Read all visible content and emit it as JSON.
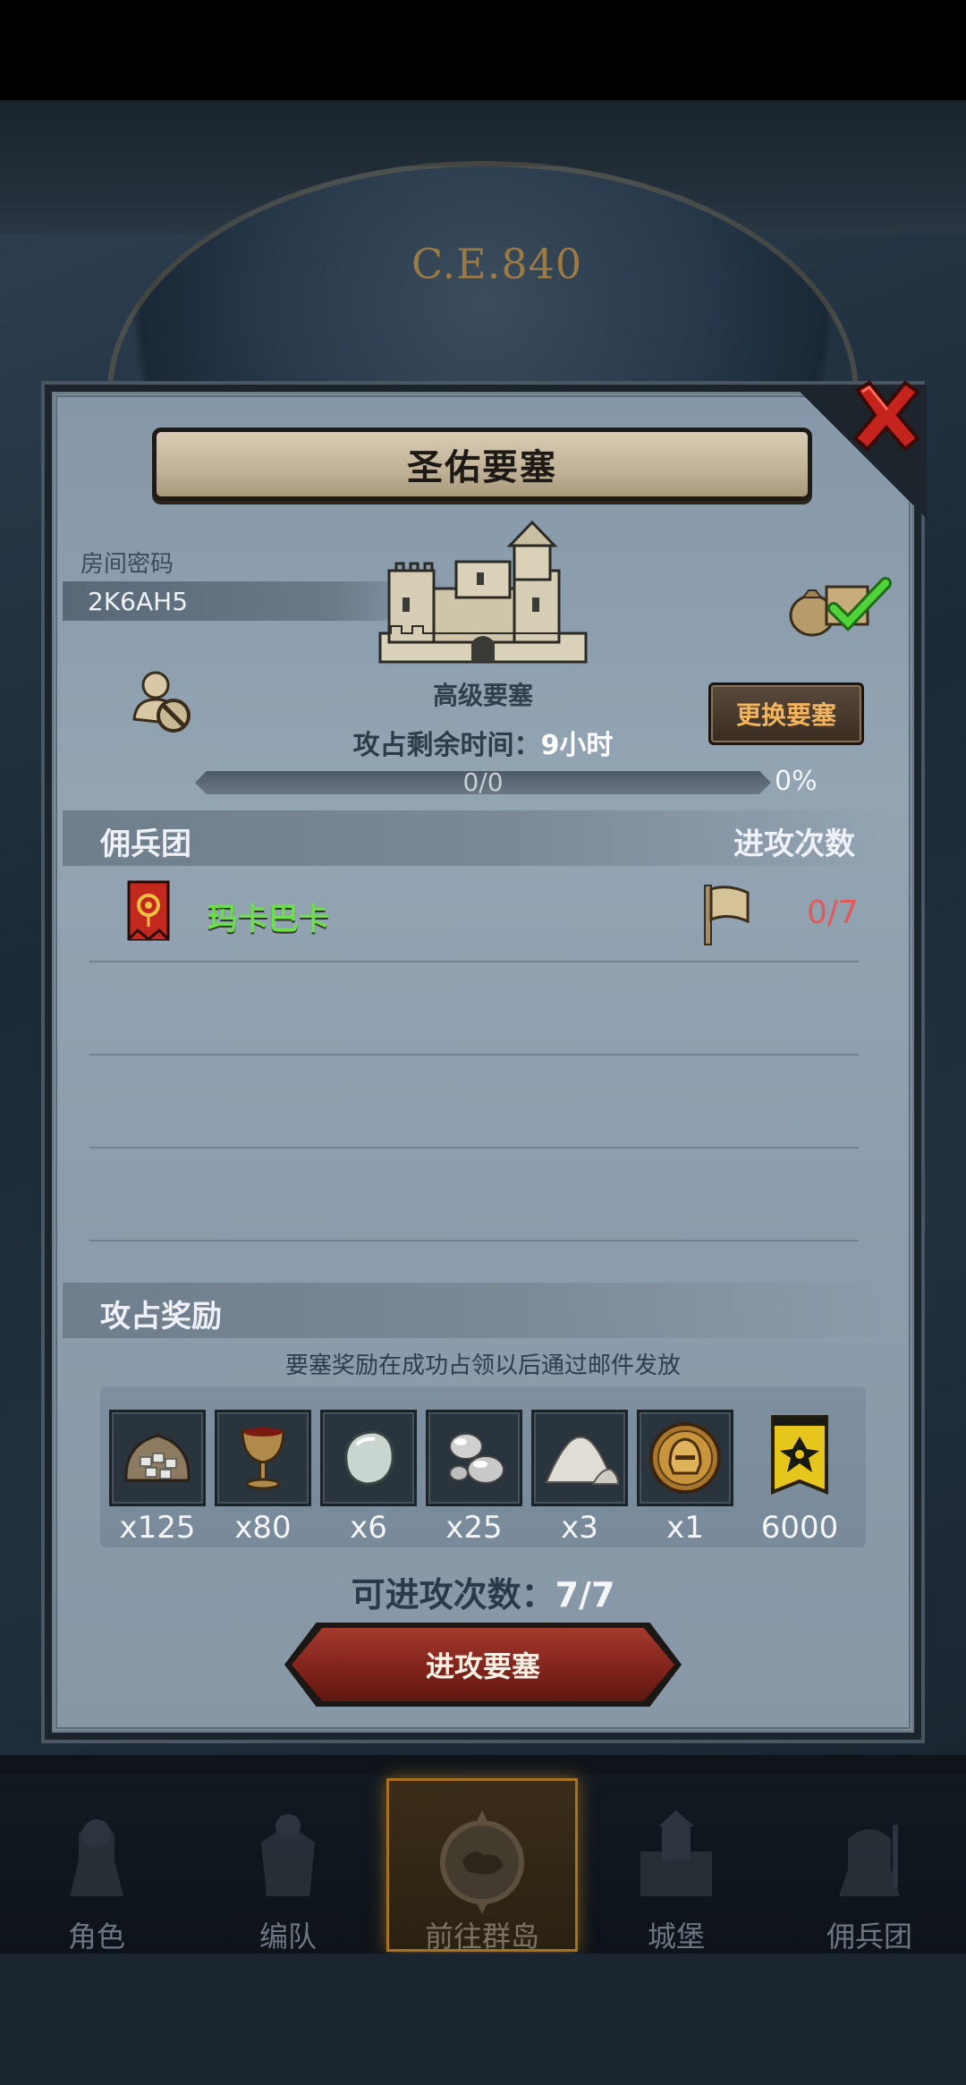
{
  "background": {
    "era": "C.E.840"
  },
  "dialog": {
    "title": "圣佑要塞",
    "room_label": "房间密码",
    "room_code": "2K6AH5",
    "fortress_tier": "高级要塞",
    "change_button": "更换要塞",
    "time_label": "攻占剩余时间：",
    "time_value": "9小时",
    "progress_text": "0/0",
    "progress_fraction": 0,
    "progress_percent": "0%",
    "merc_section": "佣兵团",
    "attack_count_header": "进攻次数",
    "mercenary": {
      "name": "玛卡巴卡",
      "attacks": "0/7"
    },
    "reward_section": "攻占奖励",
    "reward_note": "要塞奖励在成功占领以后通过邮件发放",
    "rewards": [
      {
        "icon": "silver-ore-sack-icon",
        "qty": "x125"
      },
      {
        "icon": "goblet-icon",
        "qty": "x80"
      },
      {
        "icon": "gemstone-icon",
        "qty": "x6"
      },
      {
        "icon": "silver-nuggets-icon",
        "qty": "x25"
      },
      {
        "icon": "salt-pile-icon",
        "qty": "x3"
      },
      {
        "icon": "helmet-medal-icon",
        "qty": "x1"
      },
      {
        "icon": "yellow-banner-icon",
        "qty": "6000"
      }
    ],
    "attempts_label": "可进攻次数：",
    "attempts_value": "7/7",
    "attack_button": "进攻要塞"
  },
  "nav": [
    {
      "label": "角色",
      "icon": "knight-icon"
    },
    {
      "label": "编队",
      "icon": "armor-icon"
    },
    {
      "label": "前往群岛",
      "icon": "compass-icon",
      "active": true
    },
    {
      "label": "城堡",
      "icon": "castle-icon"
    },
    {
      "label": "佣兵团",
      "icon": "mercenary-icon"
    }
  ],
  "colors": {
    "merc_name": "#6ede4f",
    "attack_count": "#e25a5a",
    "change_button_text": "#f2b45c",
    "attack_button": "#8a2a20",
    "active_nav_border": "#a9701d"
  }
}
